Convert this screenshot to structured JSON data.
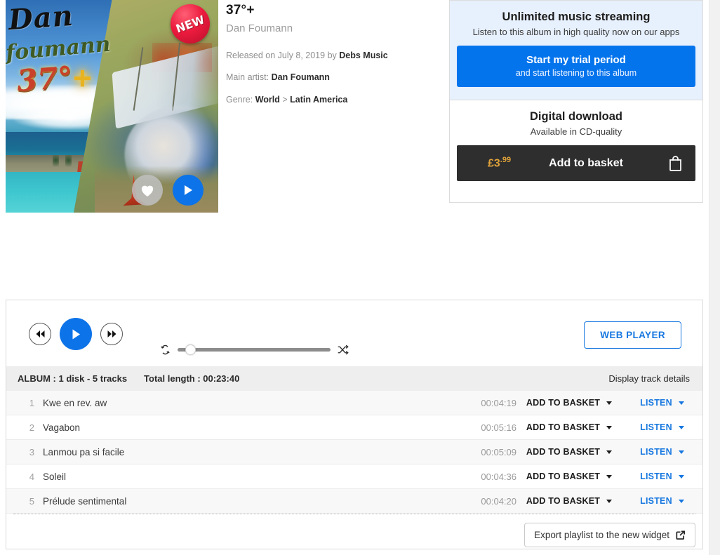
{
  "album": {
    "title": "37°+",
    "artist": "Dan Foumann",
    "released_prefix": "Released on ",
    "released_date": "July 8, 2019",
    "released_by": " by ",
    "label": "Debs Music",
    "main_artist_label": "Main artist: ",
    "main_artist": "Dan Foumann",
    "genre_label": "Genre: ",
    "genre_primary": "World",
    "genre_separator": " > ",
    "genre_secondary": "Latin America",
    "badge": "NEW",
    "cover_text": {
      "line1": "Dan",
      "line2": "foumann",
      "line3": "37°",
      "line4": "+"
    }
  },
  "purchase": {
    "streaming": {
      "title": "Unlimited music streaming",
      "subtitle": "Listen to this album in high quality now on our apps",
      "cta_primary": "Start my trial period",
      "cta_secondary": "and start listening to this album"
    },
    "download": {
      "title": "Digital download",
      "subtitle": "Available in CD-quality",
      "price_main": "£3",
      "price_cents": ".99",
      "button_label": "Add to basket"
    }
  },
  "player": {
    "web_player_label": "WEB PLAYER",
    "album_bar": {
      "album_info": "ALBUM : 1 disk - 5 tracks",
      "total_length": "Total length : 00:23:40",
      "display_details": "Display track details"
    },
    "track_actions": {
      "add_to_basket": "ADD TO BASKET",
      "listen": "LISTEN"
    },
    "tracks": [
      {
        "num": "1",
        "name": "Kwe en rev. aw",
        "duration": "00:04:19"
      },
      {
        "num": "2",
        "name": "Vagabon",
        "duration": "00:05:16"
      },
      {
        "num": "3",
        "name": "Lanmou pa si facile",
        "duration": "00:05:09"
      },
      {
        "num": "4",
        "name": "Soleil",
        "duration": "00:04:36"
      },
      {
        "num": "5",
        "name": "Prélude sentimental",
        "duration": "00:04:20"
      }
    ],
    "export_label": "Export playlist to the new widget"
  },
  "colors": {
    "accent_blue": "#0474ed",
    "dark_button": "#2e2e2e",
    "price_gold": "#e0a33a",
    "badge_red": "#ec1b3e",
    "stream_panel_bg": "#e7f0fd"
  }
}
